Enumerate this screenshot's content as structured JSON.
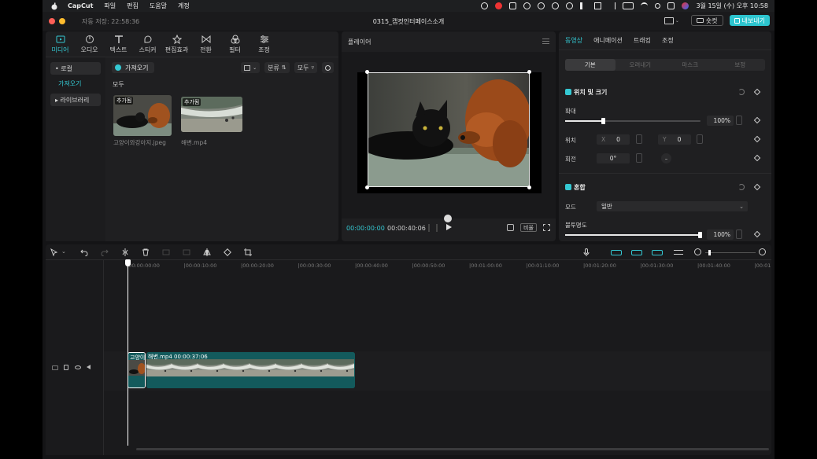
{
  "menubar": {
    "app_name": "CapCut",
    "menus": [
      "파일",
      "편집",
      "도움말",
      "계정"
    ],
    "clock": "3월 15일 (수) 오후 10:58"
  },
  "window": {
    "autosave": "자동 저장: 22:58:36",
    "project_title": "0315_캡컷인터페이스소개",
    "shortcut_label": "숏컷",
    "export_label": "내보내기"
  },
  "media": {
    "tools": [
      {
        "label": "미디어",
        "icon": "media-icon"
      },
      {
        "label": "오디오",
        "icon": "audio-icon"
      },
      {
        "label": "텍스트",
        "icon": "text-icon"
      },
      {
        "label": "스티커",
        "icon": "sticker-icon"
      },
      {
        "label": "편집효과",
        "icon": "effects-icon"
      },
      {
        "label": "전환",
        "icon": "transition-icon"
      },
      {
        "label": "필터",
        "icon": "filter-icon"
      },
      {
        "label": "조정",
        "icon": "adjust-icon"
      }
    ],
    "side": {
      "local": "• 로컬",
      "import_sub": "가져오기",
      "library": "▸ 라이브러리"
    },
    "import_label": "가져오기",
    "sort_label": "분류",
    "filter_label": "모두",
    "all_label": "모두",
    "files": [
      {
        "name": "고양이와강아지.jpeg",
        "badge": "추가됨"
      },
      {
        "name": "해변.mp4",
        "badge": "추가됨"
      }
    ]
  },
  "player": {
    "title": "플레이어",
    "current_time": "00:00:00:00",
    "total_time": "00:00:40:06",
    "ratio_label": "비율"
  },
  "inspector": {
    "tabs": [
      "동영상",
      "애니메이션",
      "트래킹",
      "조정"
    ],
    "subtabs": [
      "기본",
      "오려내기",
      "마스크",
      "보정"
    ],
    "position_size": {
      "title": "위치 및 크기",
      "scale_label": "확대",
      "scale_value": "100%",
      "scale_level": 0.1,
      "pos_label": "위치",
      "x_label": "X",
      "x_value": "0",
      "y_label": "Y",
      "y_value": "0",
      "rotate_label": "회전",
      "rotate_value": "0°",
      "rotate_extra": "–"
    },
    "blend": {
      "title": "혼합",
      "mode_label": "모드",
      "mode_value": "일반",
      "opacity_label": "불투명도",
      "opacity_value": "100%",
      "opacity_level": 1.0
    }
  },
  "timeline": {
    "ruler_ticks": [
      "00:00:00:00",
      "00:00:10:00",
      "00:00:20:00",
      "00:00:30:00",
      "00:00:40:00",
      "00:00:50:00",
      "00:01:00:00",
      "00:01:10:00",
      "00:01:20:00",
      "00:01:30:00",
      "00:01:40:00",
      "00:01"
    ],
    "clips": [
      {
        "label": "고양이"
      },
      {
        "label": "해변.mp4  00:00:37:06"
      }
    ]
  },
  "colors": {
    "accent": "#34c8d2",
    "panel": "#1f1f21",
    "clip": "#135a5c"
  }
}
